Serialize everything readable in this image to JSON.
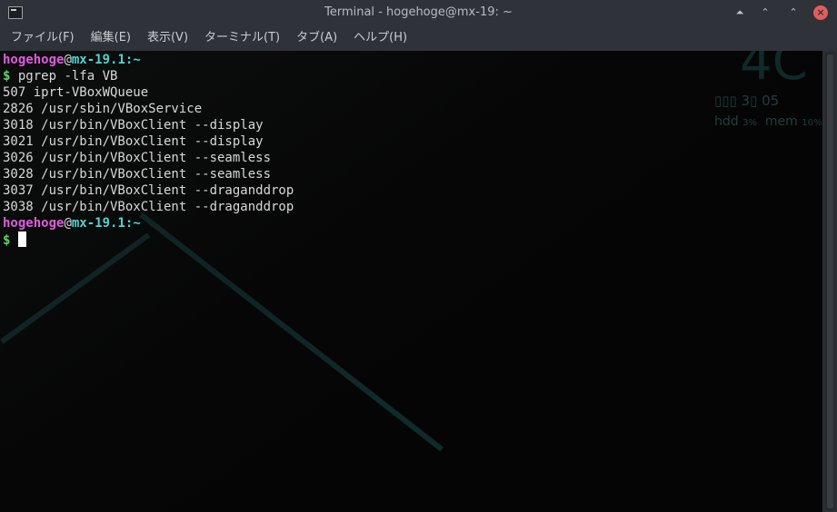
{
  "window": {
    "title": "Terminal - hogehoge@mx-19: ~",
    "controls": {
      "shade": "⏶",
      "maximize": "⌃",
      "restore": "⌃",
      "close": "×"
    }
  },
  "menu": [
    "ファイル(F)",
    "編集(E)",
    "表示(V)",
    "ターミナル(T)",
    "タブ(A)",
    "ヘルプ(H)"
  ],
  "desktop_widget": {
    "time_fragment": "4C",
    "date_fragment": "▯▯▯ 3▯ 05",
    "hdd_label": "hdd",
    "hdd_value": "3%",
    "mem_label": "mem",
    "mem_value": "10%"
  },
  "terminal": {
    "prompt1": {
      "user": "hogehoge",
      "at": "@",
      "host": "mx-19.1",
      "path": ":~",
      "symbol": "$",
      "command": " pgrep -lfa VB"
    },
    "output": [
      "507 iprt-VBoxWQueue",
      "2826 /usr/sbin/VBoxService",
      "3018 /usr/bin/VBoxClient --display",
      "3021 /usr/bin/VBoxClient --display",
      "3026 /usr/bin/VBoxClient --seamless",
      "3028 /usr/bin/VBoxClient --seamless",
      "3037 /usr/bin/VBoxClient --draganddrop",
      "3038 /usr/bin/VBoxClient --draganddrop"
    ],
    "prompt2": {
      "user": "hogehoge",
      "at": "@",
      "host": "mx-19.1",
      "path": ":~",
      "symbol": "$"
    }
  },
  "colors": {
    "user": "#e05ae0",
    "host": "#4fd4d4",
    "dollar": "#5bd75b",
    "close": "#e25d5d"
  }
}
